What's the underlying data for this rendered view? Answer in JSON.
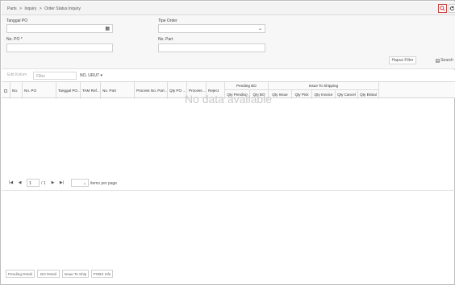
{
  "breadcrumb": [
    "Parts",
    ">",
    "Inquiry",
    ">",
    "Order Status Inquiry"
  ],
  "filters": {
    "tanggal_po_label": "Tanggal PO",
    "tipe_order_label": "Tipe Order",
    "no_po_label": "No. PO *",
    "no_part_label": "No. Part",
    "tanggal_po_value": "",
    "tipe_order_value": "",
    "no_po_value": "",
    "no_part_value": ""
  },
  "buttons": {
    "clear_filter": "Hapus Filter",
    "search": "Search"
  },
  "toolbar": {
    "edit_column": "Edit Kolom",
    "filter_placeholder": "Filter",
    "sort": "NO. URUT ▾"
  },
  "grid": {
    "columns": [
      "No.",
      "No. PO",
      "Tanggal PO...",
      "TAM Ref...",
      "No. Part",
      "Process No. Part ...",
      "Qty PO ...",
      "Process ...",
      "Reject"
    ],
    "group_pending_bo": "Pending BO",
    "group_issue_shipping": "Issue To Shipping",
    "pending_sub": [
      "Qty Pending",
      "Qty BO"
    ],
    "issue_sub": [
      "Qty Issue",
      "Qty Pick",
      "Qty Invoice",
      "Qty Cancel",
      "Qty Eksial"
    ],
    "empty_message": "No data available"
  },
  "pager": {
    "page": "1",
    "of": "/ 1",
    "size_label": "items per page"
  },
  "bottom_buttons": [
    "Pending Detail",
    "BO Detail",
    "Issue To Ship",
    "POBS Info"
  ]
}
